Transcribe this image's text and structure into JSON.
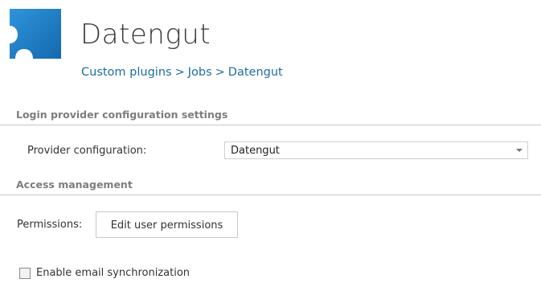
{
  "header": {
    "title": "Datengut",
    "breadcrumb": [
      "Custom plugins",
      "Jobs",
      "Datengut"
    ],
    "breadcrumb_separator": ">",
    "logo_icon": "puzzle-piece-icon",
    "logo_color": "#1f7fc7"
  },
  "sections": {
    "login": {
      "title": "Login provider configuration settings",
      "provider_label": "Provider configuration:",
      "provider_value": "Datengut"
    },
    "access": {
      "title": "Access management",
      "permissions_label": "Permissions:",
      "permissions_button": "Edit user permissions"
    }
  },
  "options": {
    "email_sync_label": "Enable email synchronization",
    "email_sync_checked": false
  },
  "colors": {
    "link": "#1c6ea4",
    "section_header": "#7d7d7d",
    "rule": "#c8c8c8"
  }
}
